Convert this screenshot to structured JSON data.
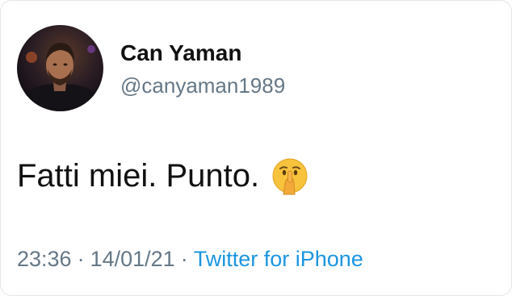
{
  "author": {
    "display_name": "Can Yaman",
    "handle": "@canyaman1989",
    "avatar_icon": "profile-photo"
  },
  "tweet": {
    "text": "Fatti miei. Punto.",
    "emoji_icon": "shushing-face-emoji"
  },
  "meta": {
    "time": "23:36",
    "separator": "·",
    "date": "14/01/21",
    "source": "Twitter for iPhone"
  },
  "colors": {
    "name": "#111111",
    "secondary": "#657786",
    "link": "#1b95e0",
    "emoji_face": "#f7c23c"
  }
}
